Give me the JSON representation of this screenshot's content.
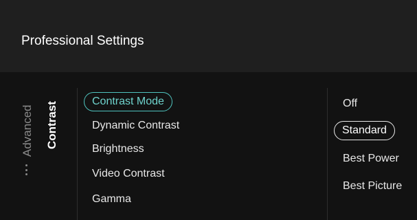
{
  "header": {
    "title": "Professional Settings"
  },
  "breadcrumb": {
    "parent": "Advanced",
    "current": "Contrast"
  },
  "menu": {
    "items": [
      "Contrast Mode",
      "Dynamic Contrast",
      "Brightness",
      "Video Contrast",
      "Gamma"
    ],
    "selected": "Contrast Mode"
  },
  "options": {
    "items": [
      "Off",
      "Standard",
      "Best Power",
      "Best Picture"
    ],
    "selected": "Standard"
  },
  "colors": {
    "accent": "#4fc4bf",
    "background": "#121212",
    "header": "#1f1f1f"
  }
}
